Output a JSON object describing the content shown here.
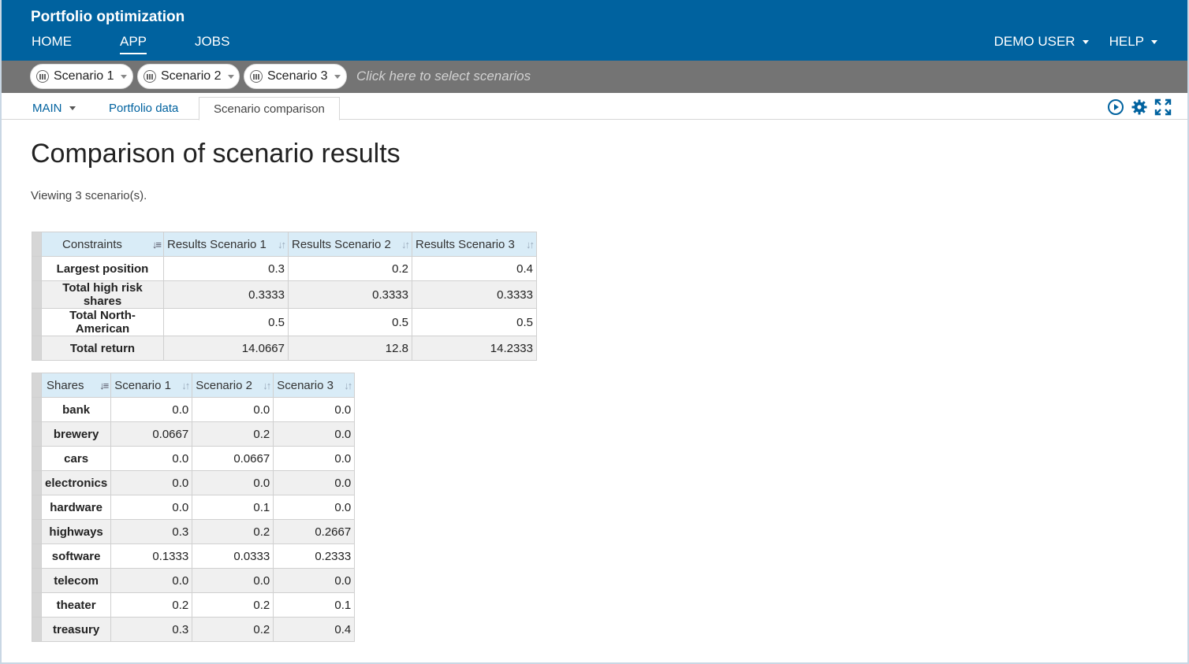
{
  "header": {
    "app_title": "Portfolio optimization",
    "nav": [
      {
        "label": "HOME"
      },
      {
        "label": "APP"
      },
      {
        "label": "JOBS"
      }
    ],
    "user_menu": "DEMO USER",
    "help_menu": "HELP",
    "accent": "#00629f"
  },
  "scenario_bar": {
    "scenarios": [
      "Scenario 1",
      "Scenario 2",
      "Scenario 3"
    ],
    "placeholder": "Click here to select scenarios",
    "background": "#747474"
  },
  "tabs": {
    "main": "MAIN",
    "portfolio_data": "Portfolio data",
    "scenario_comparison": "Scenario comparison",
    "icons": [
      "run-icon",
      "settings-icon",
      "fullscreen-icon"
    ]
  },
  "content": {
    "title": "Comparison of scenario results",
    "viewing": "Viewing 3 scenario(s).",
    "constraints_table": {
      "headers": [
        "Constraints",
        "Results Scenario 1",
        "Results Scenario 2",
        "Results Scenario 3"
      ],
      "rows": [
        {
          "label": "Largest position",
          "values": [
            "0.3",
            "0.2",
            "0.4"
          ]
        },
        {
          "label": "Total high risk shares",
          "values": [
            "0.3333",
            "0.3333",
            "0.3333"
          ]
        },
        {
          "label": "Total North-American",
          "values": [
            "0.5",
            "0.5",
            "0.5"
          ]
        },
        {
          "label": "Total return",
          "values": [
            "14.0667",
            "12.8",
            "14.2333"
          ]
        }
      ]
    },
    "shares_table": {
      "headers": [
        "Shares",
        "Scenario 1",
        "Scenario 2",
        "Scenario 3"
      ],
      "rows": [
        {
          "label": "bank",
          "values": [
            "0.0",
            "0.0",
            "0.0"
          ]
        },
        {
          "label": "brewery",
          "values": [
            "0.0667",
            "0.2",
            "0.0"
          ]
        },
        {
          "label": "cars",
          "values": [
            "0.0",
            "0.0667",
            "0.0"
          ]
        },
        {
          "label": "electronics",
          "values": [
            "0.0",
            "0.0",
            "0.0"
          ]
        },
        {
          "label": "hardware",
          "values": [
            "0.0",
            "0.1",
            "0.0"
          ]
        },
        {
          "label": "highways",
          "values": [
            "0.3",
            "0.2",
            "0.2667"
          ]
        },
        {
          "label": "software",
          "values": [
            "0.1333",
            "0.0333",
            "0.2333"
          ]
        },
        {
          "label": "telecom",
          "values": [
            "0.0",
            "0.0",
            "0.0"
          ]
        },
        {
          "label": "theater",
          "values": [
            "0.2",
            "0.2",
            "0.1"
          ]
        },
        {
          "label": "treasury",
          "values": [
            "0.3",
            "0.2",
            "0.4"
          ]
        }
      ]
    }
  }
}
